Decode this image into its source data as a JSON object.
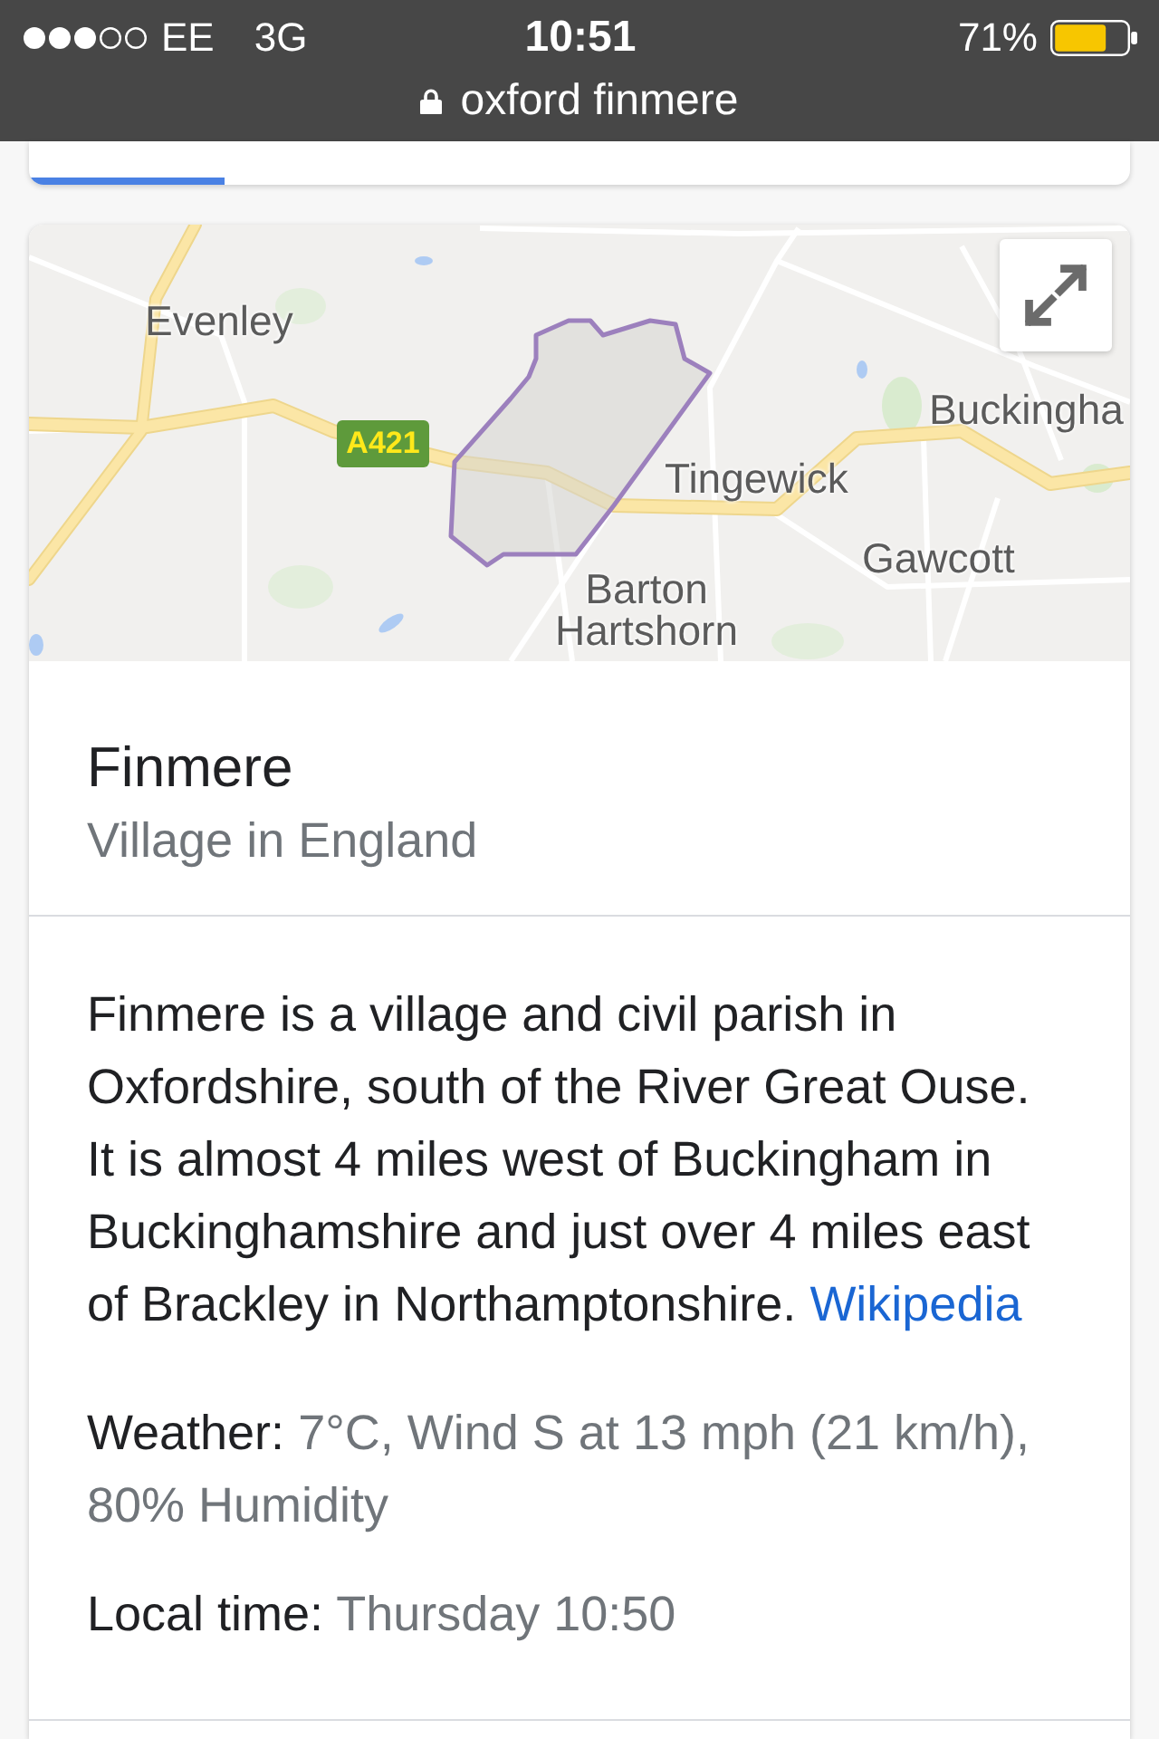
{
  "status_bar": {
    "carrier": "EE",
    "network": "3G",
    "time": "10:51",
    "battery_percent": "71%"
  },
  "address_bar": {
    "url": "oxford finmere"
  },
  "map": {
    "labels": [
      {
        "text": "Evenley"
      },
      {
        "text": "Buckingha"
      },
      {
        "text": "Tingewick"
      },
      {
        "text": "Gawcott"
      },
      {
        "text": "Barton Hartshorn"
      }
    ],
    "road_shield": "A421"
  },
  "place": {
    "title": "Finmere",
    "subtitle": "Village in England"
  },
  "description": {
    "text": "Finmere is a village and civil parish in Oxfordshire, south of the River Great Ouse. It is almost 4 miles west of Buckingham in Buckinghamshire and just over 4 miles east of Brackley in Northamptonshire.",
    "link": "Wikipedia"
  },
  "facts": [
    {
      "label": "Weather:",
      "value": "7°C, Wind S at 13 mph (21 km/h), 80% Humidity"
    },
    {
      "label": "Local time:",
      "value": "Thursday 10:50"
    }
  ]
}
